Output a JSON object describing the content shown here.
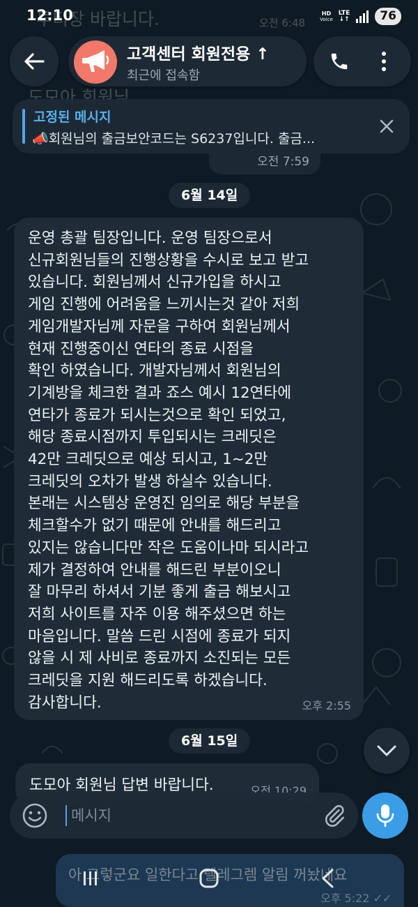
{
  "status_bar": {
    "time": "12:10",
    "hd_label": "HD",
    "voice_label": "Voice",
    "network": "LTE",
    "battery": "76"
  },
  "background_text": {
    "line1": "투티장 바랍니다.",
    "line1_time": "오전 6:48",
    "line2": "도모아 회원님"
  },
  "header": {
    "title": "고객센터 회원전용 ↑",
    "subtitle": "최근에 접속함",
    "icons": [
      "arrow-left-icon",
      "megaphone-icon",
      "phone-icon",
      "more-vertical-icon"
    ]
  },
  "pinned": {
    "title": "고정된 메시지",
    "text": "회원님의 출금보안코드는 S6237입니다. 출금...",
    "time": "오전 7:59"
  },
  "dates": {
    "first": "6월 14일",
    "second": "6월 15일"
  },
  "message1": {
    "lines": [
      "운영 총괄 팀장입니다. 운영 팀장으로서",
      "신규회원님들의 진행상황을 수시로 보고 받고",
      "있습니다. 회원님께서 신규가입을 하시고",
      "게임 진행에 어려움을 느끼시는것 같아 저희",
      "게임개발자님께 자문을 구하여 회원님께서",
      "현재 진행중이신 연타의 종료 시점을",
      "확인 하였습니다. 개발자님께서 회원님의",
      "기계방을 체크한 결과 죠스 예시 12연타에",
      "연타가 종료가 되시는것으로 확인 되었고,",
      "해당 종료시점까지 투입되시는 크레딧은",
      "42만 크레딧으로 예상 되시고, 1~2만",
      "크레딧의 오차가 발생 하실수 있습니다.",
      "본래는 시스템상 운영진 임의로 해당 부분을",
      "체크할수가 없기 때문에 안내를 해드리고",
      "있지는 않습니다만 작은 도움이나마 되시라고",
      "제가 결정하여 안내를 해드린 부분이오니",
      "잘 마무리 하셔서 기분 좋게 출금 해보시고",
      "저희 사이트를 자주 이용 해주셨으면 하는",
      "마음입니다. 말씀 드린 시점에 종료가 되지",
      "않을 시 제 사비로 종료까지 소진되는 모든",
      "크레딧을 지원 해드리도록 하겠습니다.",
      "감사합니다."
    ],
    "time": "오후 2:55"
  },
  "message2": {
    "text": "도모아 회원님 답변 바랍니다.",
    "time": "오전 10:29"
  },
  "input": {
    "placeholder": "메시지"
  },
  "outgoing": {
    "text": "아 그렇군요 일한다고 텔레그렘 알림 꺼놨네요",
    "time": "오후 5:22"
  },
  "colors": {
    "accent": "#3a9de6",
    "avatar": "#f27969",
    "bubble_in": "#1f2c38",
    "background": "#0e1a24"
  }
}
